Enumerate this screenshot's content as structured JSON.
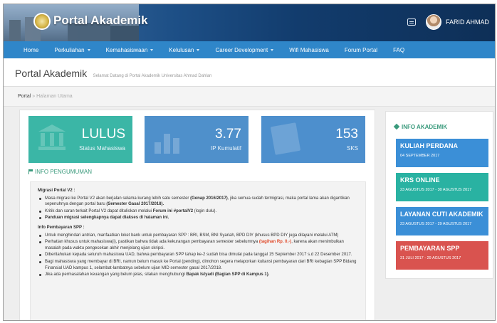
{
  "header": {
    "brand": "Portal Akademik",
    "user_name": "FARID AHMAD"
  },
  "nav": {
    "items": [
      {
        "label": "Home",
        "dropdown": false
      },
      {
        "label": "Perkuliahan",
        "dropdown": true
      },
      {
        "label": "Kemahasiswaan",
        "dropdown": true
      },
      {
        "label": "Kelulusan",
        "dropdown": true
      },
      {
        "label": "Career Development",
        "dropdown": true
      },
      {
        "label": "Wifi Mahasiswa",
        "dropdown": false
      },
      {
        "label": "Forum Portal",
        "dropdown": false
      },
      {
        "label": "FAQ",
        "dropdown": false
      }
    ]
  },
  "page": {
    "title": "Portal Akademik",
    "subtitle": "Selamat Datang di Portal Akademik Universitas Ahmad Dahlan"
  },
  "breadcrumb": {
    "home": "Portal",
    "separator": "»",
    "current": "Halaman Utama"
  },
  "stats": {
    "status": {
      "value": "LULUS",
      "label": "Status Mahasiswa",
      "color": "#3bb6a6"
    },
    "ipk": {
      "value": "3.77",
      "label": "IP Kumulatif",
      "color": "#4f90cb"
    },
    "sks": {
      "value": "153",
      "label": "SKS",
      "color": "#4d8fcd"
    }
  },
  "announcement": {
    "heading": "INFO PENGUMUMAN",
    "section1_title": "Migrasi Portal V2 :",
    "s1_item1_a": "Masa migrasi ke Portal V2 akan berjalan selama kurang lebih satu semester ",
    "s1_item1_b": "(Genap 2016/2017)",
    "s1_item1_c": ", jika semua sudah termigrasi, maka portal lama akan digantikan sepenuhnya dengan portal baru ",
    "s1_item1_d": "(Semester Gasal 2017/2018).",
    "s1_item2_a": "Kritik dan saran terkait Portal V2 dapat dituliskan melalui ",
    "s1_item2_b": "Forum ini #portalV2",
    "s1_item2_c": " (login dulu).",
    "s1_item3": "Panduan migrasi selengkapnya dapat diakses di halaman ini.",
    "section2_title": "Info Pembayaran SPP :",
    "s2_item1": "Untuk menghindari antrian, manfaatkan loket bank untuk pembayaran SPP : BRI, BSM, BNI Syariah, BPD DIY (khusus BPD DIY juga dilayani melalui ATM)",
    "s2_item2_a": "Perhatian khusus untuk mahasiswa(i), pastikan bahwa tidak ada kekurangan pembayaran semester sebelumnya ",
    "s2_item2_b": "(tagihan Rp. 0,-)",
    "s2_item2_c": ", karena akan menimbulkan masalah pada waktu pengecekan akhir menjelang ujian skripsi.",
    "s2_item3": "Diberitahukan kepada seluruh mahasiswa UAD, bahwa pembayaran SPP tahap ke-2 sudah bisa dimulai pada tanggal 15 September 2017 s.d 22 Desember 2017.",
    "s2_item4": "Bagi mahasiswa yang membayar di BRI, namun belum masuk ke Portal (pending), dimohon segera melaporkan kuitansi pembayaran dari BRI kebagian SPP Bidang Finansial UAD kampus 1, selambat-lambatnya sebelum ujian MID semester gasal 2017/2018.",
    "s2_item5_a": "Jika ada permasalahan keuangan yang belum jelas, silakan menghubungi ",
    "s2_item5_b": "Bapak Istyadi (Bagian SPP di Kampus 1)."
  },
  "info_akademik": {
    "heading": "INFO AKADEMIK",
    "cards": [
      {
        "title": "KULIAH PERDANA",
        "date": "04 SEPTEMBER 2017",
        "color": "#3b8fd7"
      },
      {
        "title": "KRS ONLINE",
        "date": "23 AGUSTUS 2017 - 30 AGUSTUS 2017",
        "color": "#29b2a2"
      },
      {
        "title": "LAYANAN CUTI AKADEMIK",
        "date": "23 AGUSTUS 2017 - 29 AGUSTUS 2017",
        "color": "#3b8fd7"
      },
      {
        "title": "PEMBAYARAN SPP",
        "date": "31 JULI 2017 - 29 AGUSTUS 2017",
        "color": "#d9534f"
      }
    ]
  },
  "icons": [
    "logo-seal",
    "chat-icon",
    "avatar",
    "bank-icon",
    "chart-icon",
    "book-icon",
    "flag-icon",
    "tag-icon"
  ]
}
